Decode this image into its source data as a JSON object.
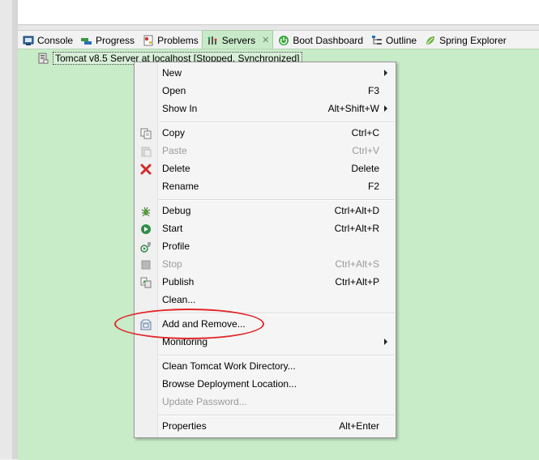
{
  "tabs": [
    {
      "label": "Console",
      "icon": "console-icon"
    },
    {
      "label": "Progress",
      "icon": "progress-icon"
    },
    {
      "label": "Problems",
      "icon": "problems-icon"
    },
    {
      "label": "Servers",
      "icon": "servers-icon",
      "active": true
    },
    {
      "label": "Boot Dashboard",
      "icon": "boot-dashboard-icon"
    },
    {
      "label": "Outline",
      "icon": "outline-icon"
    },
    {
      "label": "Spring Explorer",
      "icon": "spring-explorer-icon"
    }
  ],
  "server": {
    "label": "Tomcat v8.5 Server at localhost  [Stopped, Synchronized]"
  },
  "menu": {
    "items": [
      {
        "label": "New",
        "shortcut": "",
        "submenu": true
      },
      {
        "label": "Open",
        "shortcut": "F3"
      },
      {
        "label": "Show In",
        "shortcut": "Alt+Shift+W",
        "submenu": true
      },
      {
        "label": "Copy",
        "shortcut": "Ctrl+C",
        "icon": "copy-icon"
      },
      {
        "label": "Paste",
        "shortcut": "Ctrl+V",
        "icon": "paste-icon",
        "disabled": true
      },
      {
        "label": "Delete",
        "shortcut": "Delete",
        "icon": "delete-icon"
      },
      {
        "label": "Rename",
        "shortcut": "F2"
      },
      {
        "label": "Debug",
        "shortcut": "Ctrl+Alt+D",
        "icon": "debug-icon"
      },
      {
        "label": "Start",
        "shortcut": "Ctrl+Alt+R",
        "icon": "start-icon"
      },
      {
        "label": "Profile",
        "shortcut": "",
        "icon": "profile-icon"
      },
      {
        "label": "Stop",
        "shortcut": "Ctrl+Alt+S",
        "icon": "stop-icon",
        "disabled": true
      },
      {
        "label": "Publish",
        "shortcut": "Ctrl+Alt+P",
        "icon": "publish-icon"
      },
      {
        "label": "Clean...",
        "shortcut": ""
      },
      {
        "label": "Add and Remove...",
        "shortcut": "",
        "icon": "add-remove-icon"
      },
      {
        "label": "Monitoring",
        "shortcut": "",
        "submenu": true
      },
      {
        "label": "Clean Tomcat Work Directory...",
        "shortcut": ""
      },
      {
        "label": "Browse Deployment Location...",
        "shortcut": ""
      },
      {
        "label": "Update Password...",
        "shortcut": "",
        "disabled": true
      },
      {
        "label": "Properties",
        "shortcut": "Alt+Enter"
      }
    ]
  },
  "colors": {
    "highlight": "#e2262a",
    "view_bg": "#c8ebc8"
  }
}
